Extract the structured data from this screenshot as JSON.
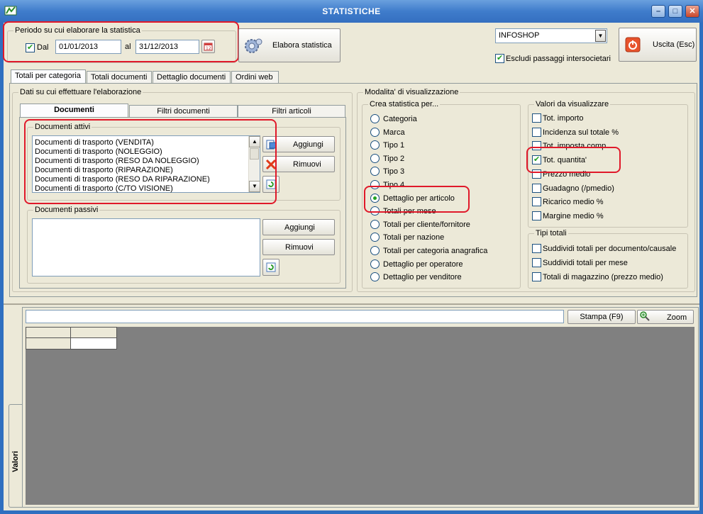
{
  "window": {
    "title": "STATISTICHE",
    "minimize": "–",
    "maximize": "□",
    "close": "✕"
  },
  "period": {
    "caption": "Periodo su cui elaborare la statistica",
    "dal_label": "Dal",
    "dal_checked": true,
    "from": "01/01/2013",
    "al_label": "al",
    "to": "31/12/2013"
  },
  "elabora_label": "Elabora statistica",
  "shop_select": "INFOSHOP",
  "escludi_label": "Escludi passaggi intersocietari",
  "uscita_label": "Uscita (Esc)",
  "main_tabs": [
    "Totali per categoria",
    "Totali documenti",
    "Dettaglio documenti",
    "Ordini web"
  ],
  "dati": {
    "caption": "Dati su cui effettuare l'elaborazione",
    "subtabs": [
      "Documenti",
      "Filtri documenti",
      "Filtri articoli"
    ],
    "attivi_caption": "Documenti attivi",
    "attivi_items": [
      "Documenti di trasporto (VENDITA)",
      "Documenti di trasporto (NOLEGGIO)",
      "Documenti di trasporto (RESO DA NOLEGGIO)",
      "Documenti di trasporto (RIPARAZIONE)",
      "Documenti di trasporto (RESO DA RIPARAZIONE)",
      "Documenti di trasporto (C/TO VISIONE)"
    ],
    "aggiungi": "Aggiungi",
    "rimuovi": "Rimuovi",
    "passivi_caption": "Documenti passivi"
  },
  "modalita": {
    "caption": "Modalita' di visualizzazione",
    "crea_caption": "Crea statistica per...",
    "radios": [
      "Categoria",
      "Marca",
      "Tipo 1",
      "Tipo 2",
      "Tipo 3",
      "Tipo 4",
      "Dettaglio per articolo",
      "Totali per mese",
      "Totali per cliente/fornitore",
      "Totali per nazione",
      "Totali per categoria anagrafica",
      "Dettaglio per operatore",
      "Dettaglio per venditore"
    ],
    "selected_radio": "Dettaglio per articolo",
    "valori_caption": "Valori da visualizzare",
    "valori": [
      "Tot. importo",
      "Incidenza sul totale %",
      "Tot. imposta comp.",
      "Tot. quantita'",
      "Prezzo medio",
      "Guadagno (/pmedio)",
      "Ricarico medio %",
      "Margine medio %"
    ],
    "valori_checked": "Tot. quantita'",
    "tipi_caption": "Tipi totali",
    "tipi": [
      "Suddividi totali per documento/causale",
      "Suddividi totali per mese",
      "Totali di magazzino (prezzo medio)"
    ]
  },
  "bottom": {
    "stampa": "Stampa (F9)",
    "zoom": "Zoom",
    "side_tab": "Valori"
  },
  "colors": {
    "title_bar": "#3f7ccb",
    "highlight_red": "#e0192a",
    "check_green": "#21a121"
  }
}
